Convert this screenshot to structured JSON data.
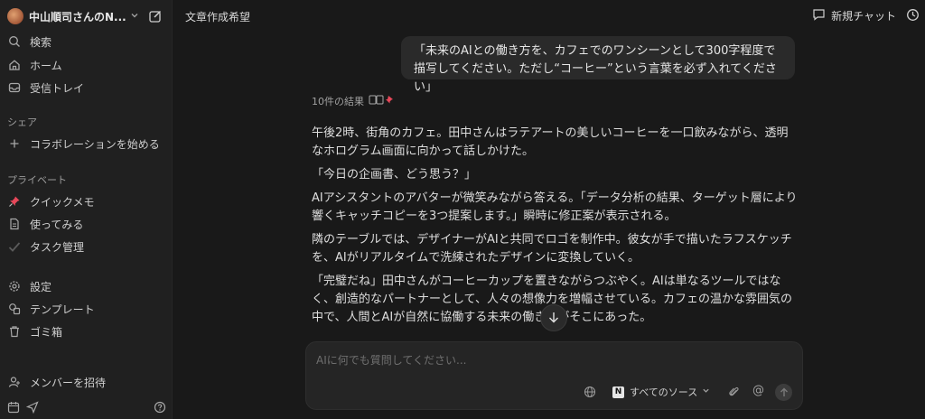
{
  "sidebar": {
    "workspace_name": "中山順司さんのN...",
    "nav": [
      {
        "label": "検索",
        "icon": "search-icon"
      },
      {
        "label": "ホーム",
        "icon": "home-icon"
      },
      {
        "label": "受信トレイ",
        "icon": "inbox-icon"
      }
    ],
    "share_section": "シェア",
    "share_item": "コラボレーションを始める",
    "private_section": "プライベート",
    "private_items": [
      {
        "label": "クイックメモ",
        "icon": "pin-icon"
      },
      {
        "label": "使ってみる",
        "icon": "page-icon"
      },
      {
        "label": "タスク管理",
        "icon": "check-icon"
      }
    ],
    "tools": [
      {
        "label": "設定",
        "icon": "gear-icon"
      },
      {
        "label": "テンプレート",
        "icon": "template-icon"
      },
      {
        "label": "ゴミ箱",
        "icon": "trash-icon"
      }
    ],
    "invite": "メンバーを招待"
  },
  "header": {
    "title": "文章作成希望",
    "new_chat": "新規チャット"
  },
  "chat": {
    "user_message": "「未来のAIとの働き方を、カフェでのワンシーンとして300字程度で描写してください。ただし“コーヒー”という言葉を必ず入れてください」",
    "results_label": "10件の結果",
    "answer": [
      "午後2時、街角のカフェ。田中さんはラテアートの美しいコーヒーを一口飲みながら、透明なホログラム画面に向かって話しかけた。",
      "「今日の企画書、どう思う？」",
      "AIアシスタントのアバターが微笑みながら答える。「データ分析の結果、ターゲット層により響くキャッチコピーを3つ提案します。」瞬時に修正案が表示される。",
      "隣のテーブルでは、デザイナーがAIと共同でロゴを制作中。彼女が手で描いたラフスケッチを、AIがリアルタイムで洗練されたデザインに変換していく。",
      "「完璧だね」田中さんがコーヒーカップを置きながらつぶやく。AIは単なるツールではなく、創造的なパートナーとして、人々の想像力を増幅させている。カフェの温かな雰囲気の中で、人間とAIが自然に協働する未来の働き方がそこにあった。"
    ]
  },
  "composer": {
    "placeholder": "AIに何でも質問してください...",
    "source_label": "すべてのソース",
    "badge_letter": "N"
  }
}
